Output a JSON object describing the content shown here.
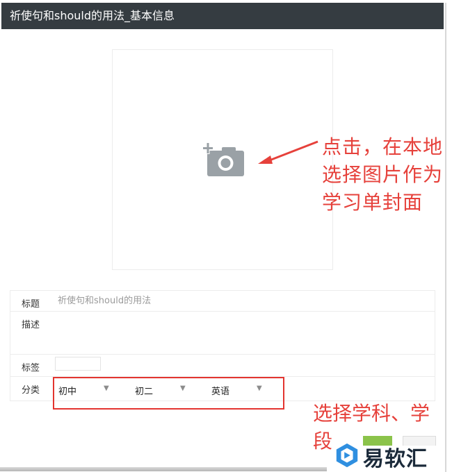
{
  "window": {
    "title": "祈使句和should的用法_基本信息"
  },
  "cover": {
    "icon": "add-photo-camera-icon"
  },
  "annotations": {
    "cover_tip": "点击，在本地选择图片作为学习单封面",
    "category_tip": "选择学科、学段"
  },
  "form": {
    "title_label": "标题",
    "title_value": "祈使句和should的用法",
    "desc_label": "描述",
    "tag_label": "标签",
    "category_label": "分类",
    "category": {
      "stage": "初中",
      "grade": "初二",
      "subject": "英语"
    }
  },
  "watermark": {
    "text": "易软汇"
  },
  "colors": {
    "titlebar_bg": "#353c41",
    "annotation_red": "#e6413b",
    "icon_grey": "#9aa1a6",
    "confirm_green": "#8bc34a"
  }
}
